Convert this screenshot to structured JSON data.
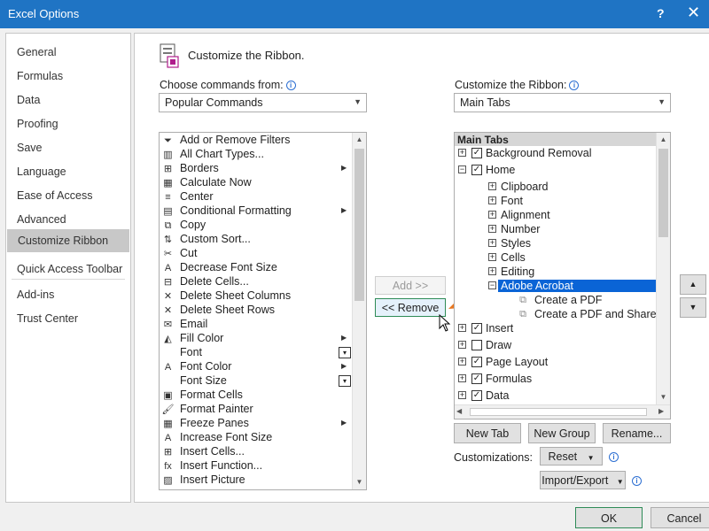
{
  "window": {
    "title": "Excel Options",
    "help": "?",
    "close": "✕"
  },
  "nav": {
    "items": [
      {
        "label": "General",
        "selected": false
      },
      {
        "label": "Formulas",
        "selected": false
      },
      {
        "label": "Data",
        "selected": false
      },
      {
        "label": "Proofing",
        "selected": false
      },
      {
        "label": "Save",
        "selected": false
      },
      {
        "label": "Language",
        "selected": false
      },
      {
        "label": "Ease of Access",
        "selected": false
      },
      {
        "label": "Advanced",
        "selected": false
      },
      {
        "label": "Customize Ribbon",
        "selected": true
      },
      {
        "label": "Quick Access Toolbar",
        "selected": false
      },
      {
        "label": "Add-ins",
        "selected": false
      },
      {
        "label": "Trust Center",
        "selected": false
      }
    ]
  },
  "main": {
    "heading": "Customize the Ribbon.",
    "commands_label": "Choose commands from:",
    "commands_dropdown": "Popular Commands",
    "ribbon_label": "Customize the Ribbon:",
    "ribbon_dropdown": "Main Tabs",
    "commands": [
      {
        "label": "Add or Remove Filters",
        "icon": "filter-icon",
        "glyph": "⏷",
        "submenu": false
      },
      {
        "label": "All Chart Types...",
        "icon": "chart-icon",
        "glyph": "▥",
        "submenu": false
      },
      {
        "label": "Borders",
        "icon": "borders-icon",
        "glyph": "⊞",
        "submenu": true
      },
      {
        "label": "Calculate Now",
        "icon": "calculator-icon",
        "glyph": "▦",
        "submenu": false
      },
      {
        "label": "Center",
        "icon": "center-align-icon",
        "glyph": "≡",
        "submenu": false
      },
      {
        "label": "Conditional Formatting",
        "icon": "conditional-format-icon",
        "glyph": "▤",
        "submenu": true
      },
      {
        "label": "Copy",
        "icon": "copy-icon",
        "glyph": "⧉",
        "submenu": false
      },
      {
        "label": "Custom Sort...",
        "icon": "sort-icon",
        "glyph": "⇅",
        "submenu": false
      },
      {
        "label": "Cut",
        "icon": "scissors-icon",
        "glyph": "✂",
        "submenu": false
      },
      {
        "label": "Decrease Font Size",
        "icon": "decrease-font-icon",
        "glyph": "A",
        "submenu": false
      },
      {
        "label": "Delete Cells...",
        "icon": "delete-cells-icon",
        "glyph": "⊟",
        "submenu": false
      },
      {
        "label": "Delete Sheet Columns",
        "icon": "delete-columns-icon",
        "glyph": "✕",
        "submenu": false
      },
      {
        "label": "Delete Sheet Rows",
        "icon": "delete-rows-icon",
        "glyph": "✕",
        "submenu": false
      },
      {
        "label": "Email",
        "icon": "email-icon",
        "glyph": "✉",
        "submenu": false
      },
      {
        "label": "Fill Color",
        "icon": "fill-color-icon",
        "glyph": "◭",
        "submenu": true
      },
      {
        "label": "Font",
        "icon": "font-icon",
        "glyph": "",
        "submenu": false,
        "box": true
      },
      {
        "label": "Font Color",
        "icon": "font-color-icon",
        "glyph": "A",
        "submenu": true
      },
      {
        "label": "Font Size",
        "icon": "font-size-icon",
        "glyph": "",
        "submenu": false,
        "box": true
      },
      {
        "label": "Format Cells",
        "icon": "format-cells-icon",
        "glyph": "▣",
        "submenu": false
      },
      {
        "label": "Format Painter",
        "icon": "format-painter-icon",
        "glyph": "🖌",
        "submenu": false
      },
      {
        "label": "Freeze Panes",
        "icon": "freeze-panes-icon",
        "glyph": "▦",
        "submenu": true
      },
      {
        "label": "Increase Font Size",
        "icon": "increase-font-icon",
        "glyph": "A",
        "submenu": false
      },
      {
        "label": "Insert Cells...",
        "icon": "insert-cells-icon",
        "glyph": "⊞",
        "submenu": false
      },
      {
        "label": "Insert Function...",
        "icon": "function-icon",
        "glyph": "fx",
        "submenu": false
      },
      {
        "label": "Insert Picture",
        "icon": "picture-icon",
        "glyph": "▨",
        "submenu": false
      }
    ],
    "tree": {
      "header": "Main Tabs",
      "rows": [
        {
          "label": "Background Removal",
          "level": 0,
          "expander": "+",
          "checked": true,
          "selected": false,
          "sub": false
        },
        {
          "label": "Home",
          "level": 0,
          "expander": "−",
          "checked": true,
          "selected": false,
          "sub": false
        },
        {
          "label": "Clipboard",
          "level": 1,
          "expander": "+",
          "checked": null,
          "selected": false,
          "sub": false
        },
        {
          "label": "Font",
          "level": 1,
          "expander": "+",
          "checked": null,
          "selected": false,
          "sub": false
        },
        {
          "label": "Alignment",
          "level": 1,
          "expander": "+",
          "checked": null,
          "selected": false,
          "sub": false
        },
        {
          "label": "Number",
          "level": 1,
          "expander": "+",
          "checked": null,
          "selected": false,
          "sub": false
        },
        {
          "label": "Styles",
          "level": 1,
          "expander": "+",
          "checked": null,
          "selected": false,
          "sub": false
        },
        {
          "label": "Cells",
          "level": 1,
          "expander": "+",
          "checked": null,
          "selected": false,
          "sub": false
        },
        {
          "label": "Editing",
          "level": 1,
          "expander": "+",
          "checked": null,
          "selected": false,
          "sub": false
        },
        {
          "label": "Adobe Acrobat",
          "level": 1,
          "expander": "−",
          "checked": null,
          "selected": true,
          "sub": false
        },
        {
          "label": "Create a PDF",
          "level": 2,
          "expander": null,
          "checked": null,
          "selected": false,
          "sub": true
        },
        {
          "label": "Create a PDF and Share link",
          "level": 2,
          "expander": null,
          "checked": null,
          "selected": false,
          "sub": true
        },
        {
          "label": "Insert",
          "level": 0,
          "expander": "+",
          "checked": true,
          "selected": false,
          "sub": false
        },
        {
          "label": "Draw",
          "level": 0,
          "expander": "+",
          "checked": false,
          "selected": false,
          "sub": false
        },
        {
          "label": "Page Layout",
          "level": 0,
          "expander": "+",
          "checked": true,
          "selected": false,
          "sub": false
        },
        {
          "label": "Formulas",
          "level": 0,
          "expander": "+",
          "checked": true,
          "selected": false,
          "sub": false
        },
        {
          "label": "Data",
          "level": 0,
          "expander": "+",
          "checked": true,
          "selected": false,
          "sub": false
        }
      ]
    },
    "add_button": "Add >>",
    "remove_button": "<< Remove",
    "new_tab_button": "New Tab",
    "new_group_button": "New Group",
    "rename_button": "Rename...",
    "customizations_label": "Customizations:",
    "reset_button": "Reset",
    "import_export_button": "Import/Export"
  },
  "footer": {
    "ok": "OK",
    "cancel": "Cancel"
  },
  "colors": {
    "titlebar": "#1f74c4",
    "selection": "#0a64d6",
    "arrow": "#e8761f"
  }
}
